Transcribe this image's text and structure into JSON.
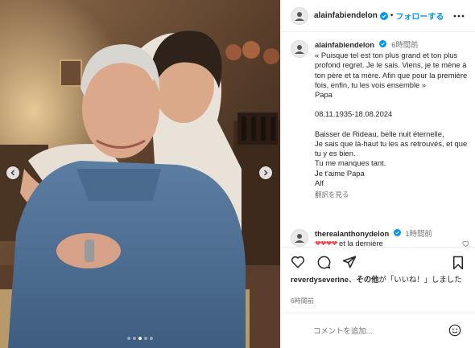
{
  "header": {
    "username": "alainfabiendelon",
    "dot": "•",
    "follow_label": "フォローする"
  },
  "caption": {
    "username": "alainfabiendelon",
    "time": "6時間前",
    "text": "« Puisque tel est ton plus grand et ton plus profond regret. Je le sais. Viens, je te mène à ton père et ta mère. Afin que pour la première fois, enfin, tu les vois ensemble »\nPapa\n\n08.11.1935-18.08.2024\n\nBaisser de Rideau, belle nuit éternelle,\nJe sais que là-haut tu les as retrouvés, et que tu y es bien.\nTu me manques tant.\nJe t'aime Papa\nAlf",
    "translate_label": "翻訳を見る"
  },
  "comment": {
    "username": "therealanthonydelon",
    "time": "1時間前",
    "hearts": "❤❤❤❤",
    "text": "et la dernière"
  },
  "likes": {
    "username": "reverdyseverine",
    "connector": "、",
    "others": "その他",
    "suffix": "が「いいね！」しました"
  },
  "post_time": "6時間前",
  "comment_input": {
    "placeholder": "コメントを追加..."
  },
  "carousel": {
    "count": 5,
    "active": 2
  },
  "icons": {
    "more": "more-horizontal-icon",
    "like": "heart-icon",
    "comment": "comment-bubble-icon",
    "share": "paper-plane-icon",
    "save": "bookmark-icon",
    "emoji": "smiley-icon",
    "verified": "verified-badge-icon"
  },
  "colors": {
    "link_blue": "#0095f6",
    "text": "#262626",
    "muted": "#737373",
    "heart_red": "#ed4956"
  }
}
